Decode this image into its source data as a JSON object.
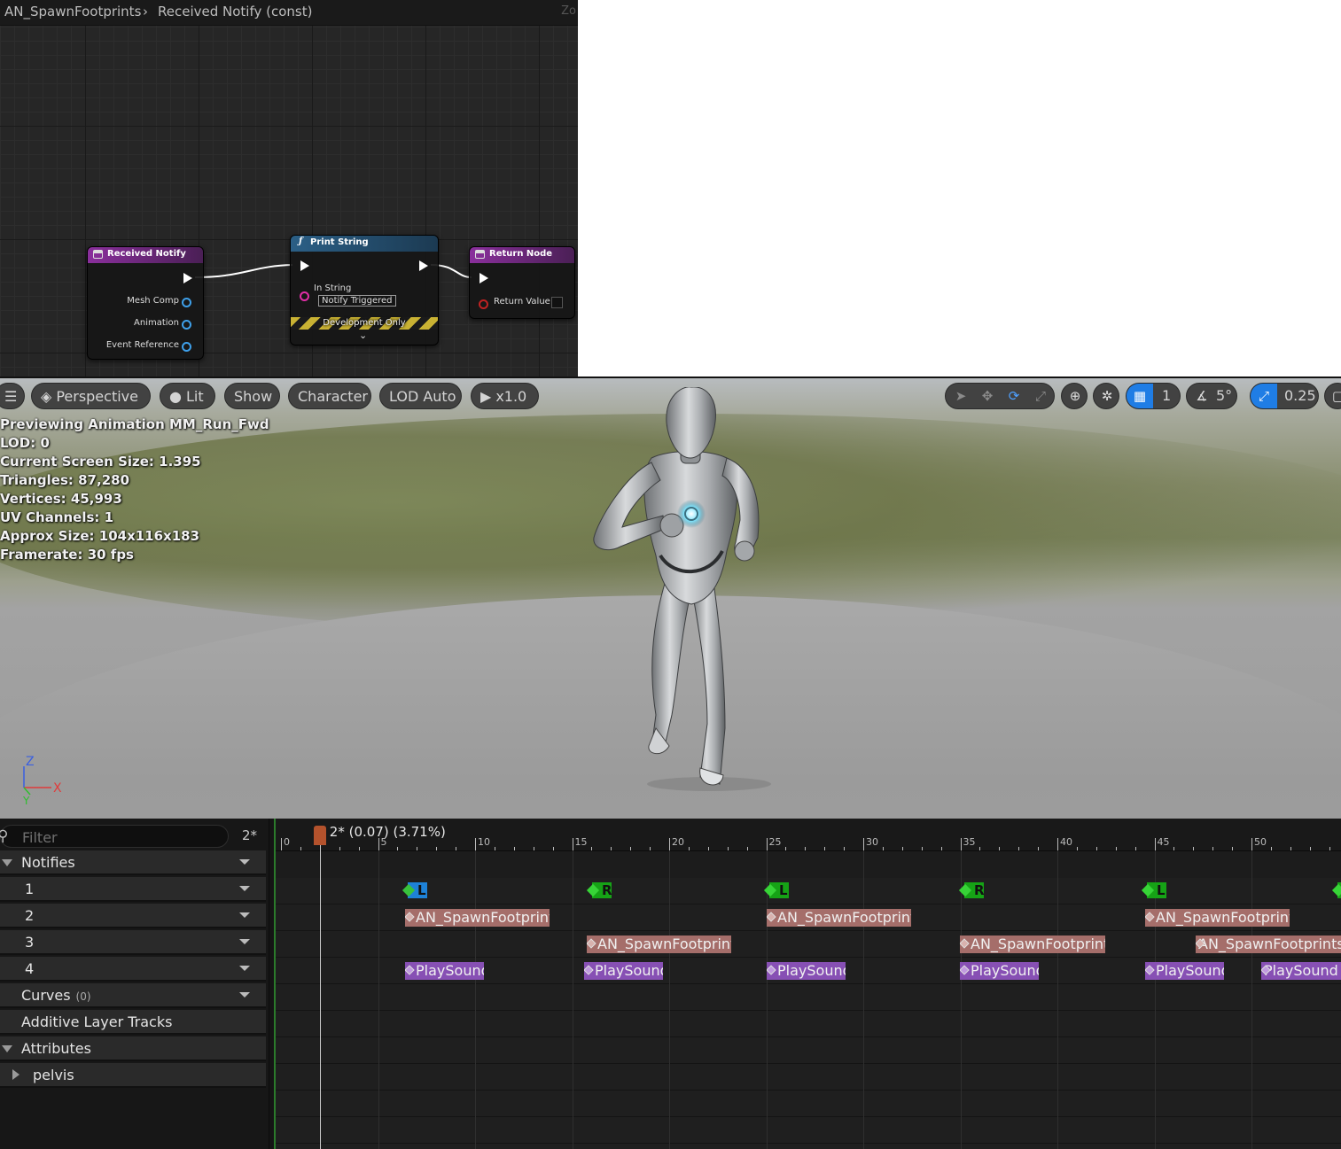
{
  "blueprint": {
    "breadcrumb": [
      "AN_SpawnFootprints",
      "Received Notify (const)"
    ],
    "zoom_label": "Zo",
    "nodes": {
      "received_notify": {
        "title": "Received Notify",
        "pins": [
          "Mesh Comp",
          "Animation",
          "Event Reference"
        ]
      },
      "print_string": {
        "title": "Print String",
        "in_string_label": "In String",
        "in_string_value": "Notify Triggered",
        "dev_label": "Development Only"
      },
      "return_node": {
        "title": "Return Node",
        "pin": "Return Value"
      }
    }
  },
  "viewport": {
    "toolbar": {
      "perspective": "Perspective",
      "lit": "Lit",
      "show": "Show",
      "character": "Character",
      "lod": "LOD Auto",
      "speed": "x1.0",
      "grid_value": "1",
      "angle_value": "5°",
      "scale_value": "0.25"
    },
    "info": [
      "Previewing Animation MM_Run_Fwd",
      "LOD: 0",
      "Current Screen Size: 1.395",
      "Triangles: 87,280",
      "Vertices: 45,993",
      "UV Channels: 1",
      "Approx Size: 104x116x183",
      "Framerate: 30 fps"
    ],
    "axes": {
      "z": "Z",
      "x": "X",
      "y": "Y"
    }
  },
  "timeline": {
    "filter_placeholder": "Filter",
    "frame_tag": "2*",
    "scrub_text": "2* (0.07) (3.71%)",
    "scrub_frame": 2,
    "ruler_labels": [
      "0",
      "5",
      "10",
      "15",
      "20",
      "25",
      "30",
      "35",
      "40",
      "45",
      "50"
    ],
    "tracks": {
      "notifies": "Notifies",
      "rows": [
        "1",
        "2",
        "3",
        "4"
      ],
      "curves": "Curves",
      "curves_count": "(0)",
      "additive": "Additive Layer Tracks",
      "attributes": "Attributes",
      "pelvis": "pelvis"
    },
    "markers": [
      "L",
      "R",
      "L",
      "R",
      "L"
    ],
    "footprint_label": "AN_SpawnFootprints",
    "sound_label": "PlaySound"
  },
  "colors": {
    "event_header": "#8a2f9c",
    "function_header": "#2b5f86",
    "footprint_notify": "#a56e6a",
    "sound_notify": "#8750b4",
    "marker": "#16a316",
    "scrub": "#b4522c"
  }
}
